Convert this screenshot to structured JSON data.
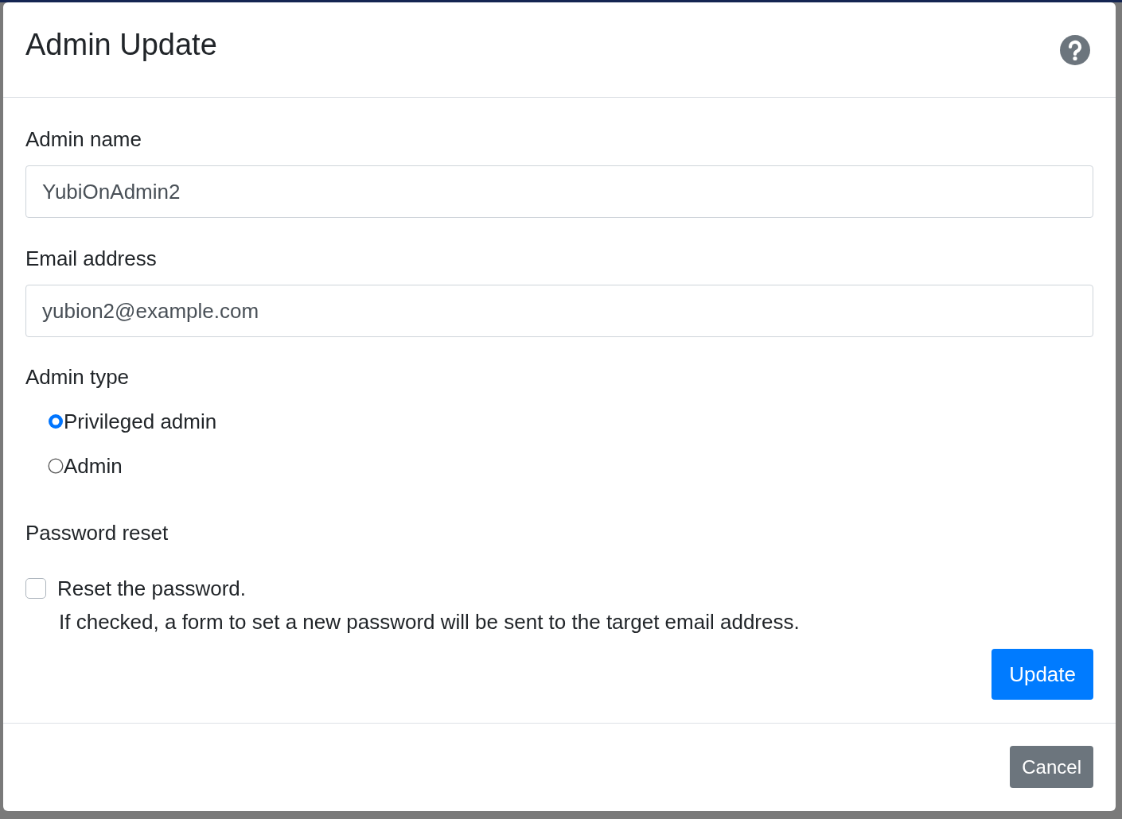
{
  "dialog": {
    "title": "Admin Update",
    "fields": [
      {
        "label": "Admin name",
        "value": "YubiOnAdmin2"
      },
      {
        "label": "Email address",
        "value": "yubion2@example.com"
      }
    ],
    "admin_type": {
      "label": "Admin type",
      "options": [
        {
          "label": "Privileged admin",
          "selected": true
        },
        {
          "label": "Admin",
          "selected": false
        }
      ]
    },
    "password_reset": {
      "label": "Password reset",
      "checkbox_label": "Reset the password.",
      "checked": false,
      "help": "If checked, a form to set a new password will be sent to the target email address."
    },
    "submit_button": "Update",
    "cancel_button": "Cancel"
  }
}
